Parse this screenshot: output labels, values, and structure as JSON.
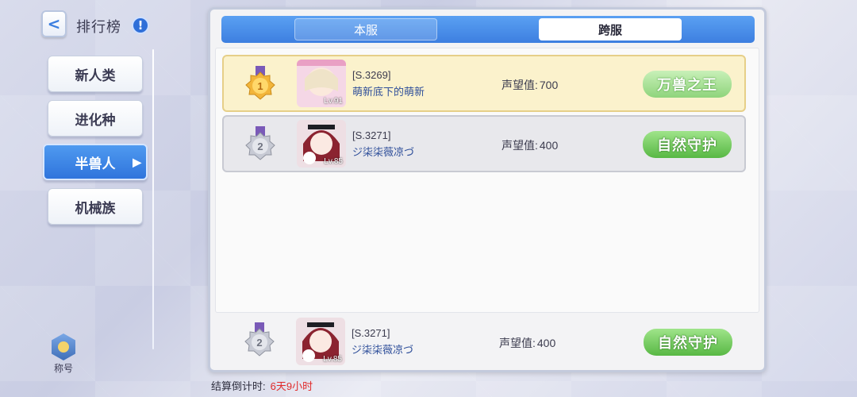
{
  "header": {
    "title": "排行榜",
    "info_icon": "!",
    "back_icon": "<"
  },
  "categories": [
    {
      "label": "新人类"
    },
    {
      "label": "进化种"
    },
    {
      "label": "半兽人",
      "active": true
    },
    {
      "label": "机械族"
    }
  ],
  "title_badge": {
    "label": "称号"
  },
  "tabs": {
    "local": "本服",
    "cross": "跨服",
    "selected": "跨服"
  },
  "rows": [
    {
      "rank": "1",
      "server": "[S.3269]",
      "name": "萌新底下的萌新",
      "prestige_label": "声望值:",
      "prestige": "700",
      "title": "万兽之王",
      "level": "Lv.91"
    },
    {
      "rank": "2",
      "server": "[S.3271]",
      "name": "ジ柒柒薇凉づ",
      "prestige_label": "声望值:",
      "prestige": "400",
      "title": "自然守护",
      "level": "Lv.85"
    }
  ],
  "self_row": {
    "rank": "2",
    "server": "[S.3271]",
    "name": "ジ柒柒薇凉づ",
    "prestige_label": "声望值:",
    "prestige": "400",
    "title": "自然守护",
    "level": "Lv.85"
  },
  "countdown": {
    "label": "结算倒计时:",
    "time": "6天9小时"
  },
  "colors": {
    "accent": "#3d7fe0",
    "gold_row": "#fbf2cc",
    "silver_row": "#e8e8ec",
    "countdown_time": "#e02a2a"
  }
}
